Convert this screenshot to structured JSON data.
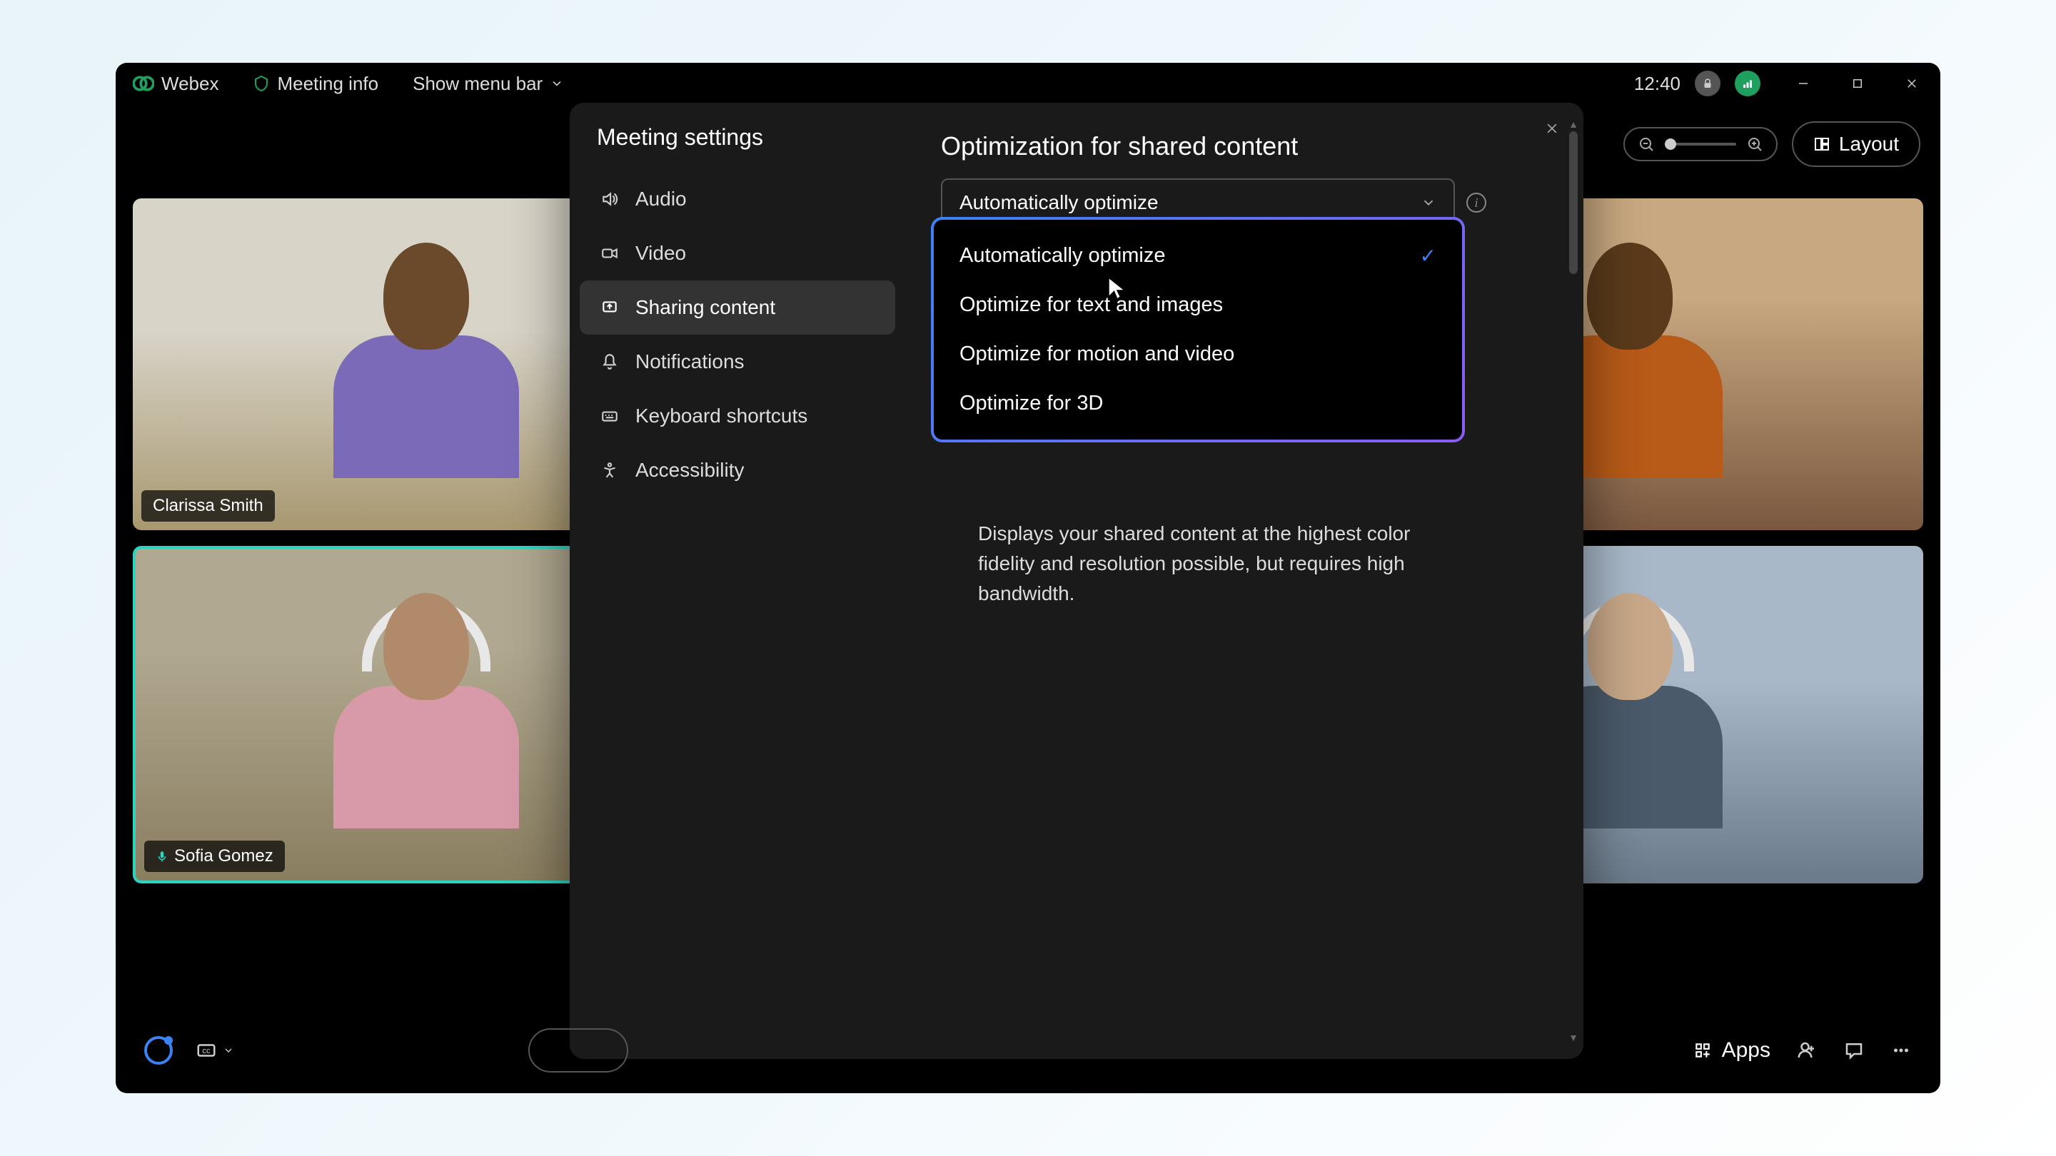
{
  "titlebar": {
    "app_name": "Webex",
    "meeting_info": "Meeting info",
    "menu_bar": "Show menu bar",
    "clock": "12:40"
  },
  "topcontrols": {
    "layout_label": "Layout"
  },
  "participants": [
    {
      "name": "Clarissa Smith"
    },
    {
      "name": "Sofia Gomez"
    }
  ],
  "settings": {
    "title": "Meeting settings",
    "nav": [
      {
        "label": "Audio",
        "icon": "speaker"
      },
      {
        "label": "Video",
        "icon": "camera"
      },
      {
        "label": "Sharing content",
        "icon": "share",
        "active": true
      },
      {
        "label": "Notifications",
        "icon": "bell"
      },
      {
        "label": "Keyboard shortcuts",
        "icon": "keyboard"
      },
      {
        "label": "Accessibility",
        "icon": "accessibility"
      }
    ],
    "content": {
      "heading": "Optimization for shared content",
      "selected": "Automatically optimize",
      "options": [
        "Automatically optimize",
        "Optimize for text and images",
        "Optimize for motion and video",
        "Optimize for 3D"
      ],
      "tooltip": "Displays your shared content at the highest color fidelity and resolution possible, but requires high bandwidth."
    }
  },
  "bottombar": {
    "apps_label": "Apps"
  }
}
